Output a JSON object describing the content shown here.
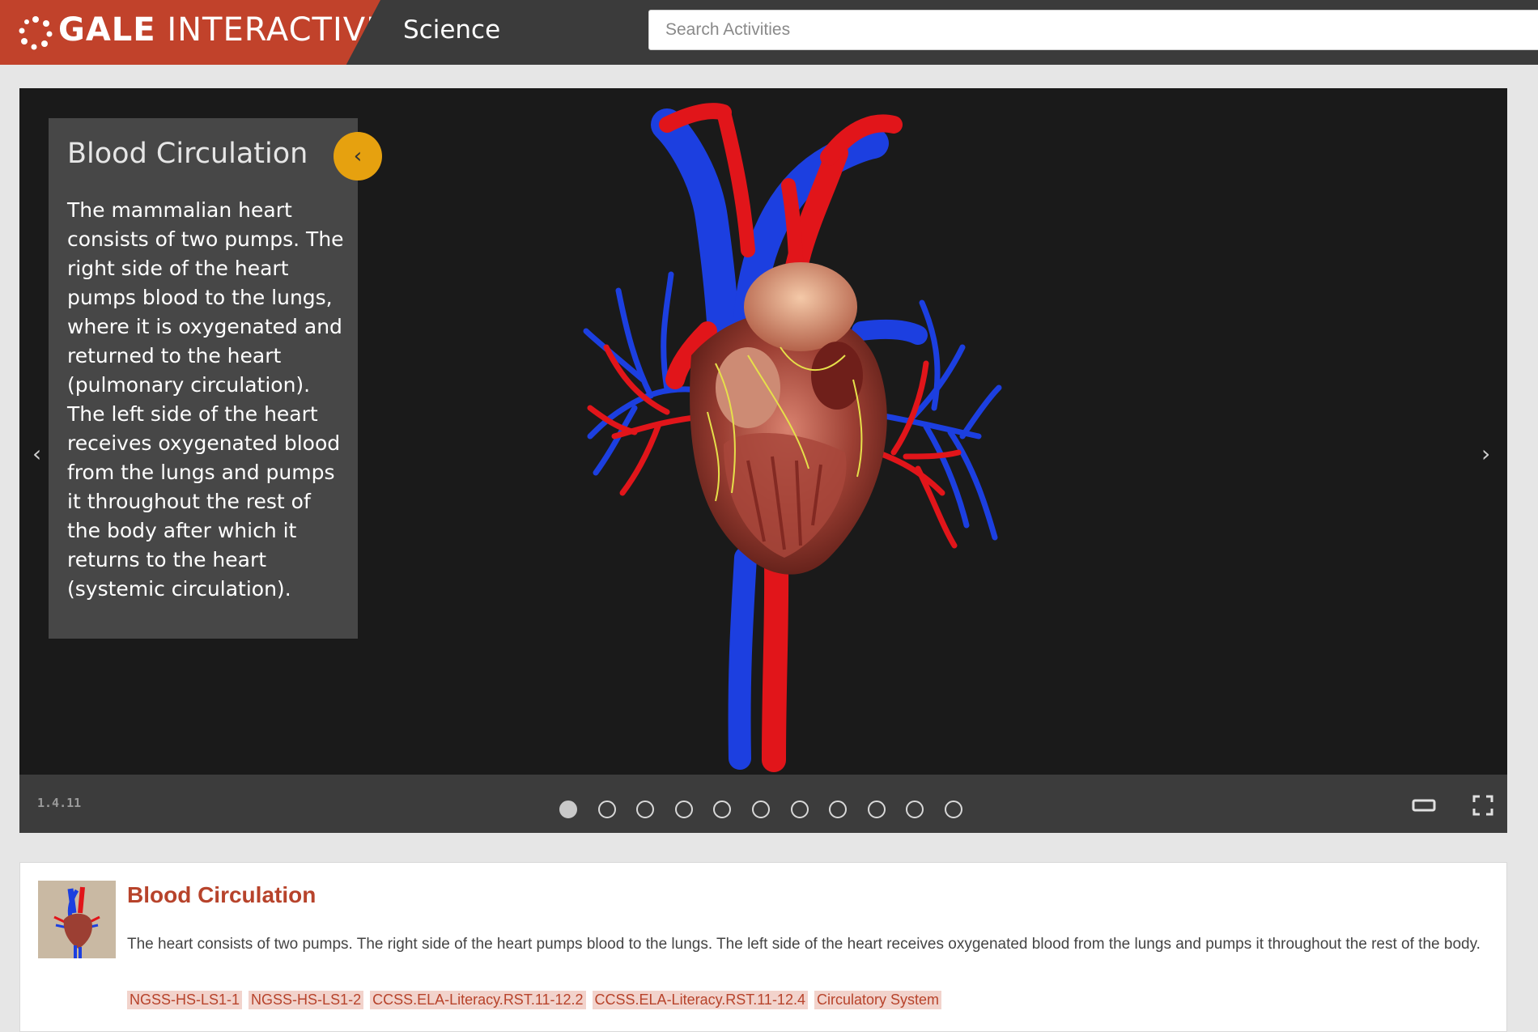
{
  "header": {
    "brand_bold": "GALE",
    "brand_light": "INTERACTIVE",
    "section": "Science",
    "search_placeholder": "Search Activities"
  },
  "viewer": {
    "panel_title": "Blood Circulation",
    "panel_body": "The mammalian heart consists of two pumps. The right side of the heart pumps blood to the lungs, where it is oxygenated and returned to the heart (pulmonary circulation). The left side of the heart receives oxygenated blood from the lungs and pumps it throughout the rest of the body after which it returns to the heart (systemic circulation).",
    "version": "1.4.11",
    "slide_count": 11,
    "active_slide": 1,
    "icons": {
      "collapse": "chevron-left-icon",
      "prev": "chevron-left-icon",
      "next": "chevron-right-icon",
      "theater": "theater-mode-icon",
      "fullscreen": "fullscreen-icon"
    }
  },
  "card": {
    "title": "Blood Circulation",
    "description": "The heart consists of two pumps. The right side of the heart pumps blood to the lungs. The left side of the heart receives oxygenated blood from the lungs and pumps it throughout the rest of the body.",
    "tags": [
      "NGSS-HS-LS1-1",
      "NGSS-HS-LS1-2",
      "CCSS.ELA-Literacy.RST.11-12.2",
      "CCSS.ELA-Literacy.RST.11-12.4",
      "Circulatory System"
    ]
  },
  "colors": {
    "brand": "#c1422b",
    "accent": "#e6a10f",
    "artery": "#e1151a",
    "vein": "#1c3fe0",
    "link": "#b7432b"
  }
}
